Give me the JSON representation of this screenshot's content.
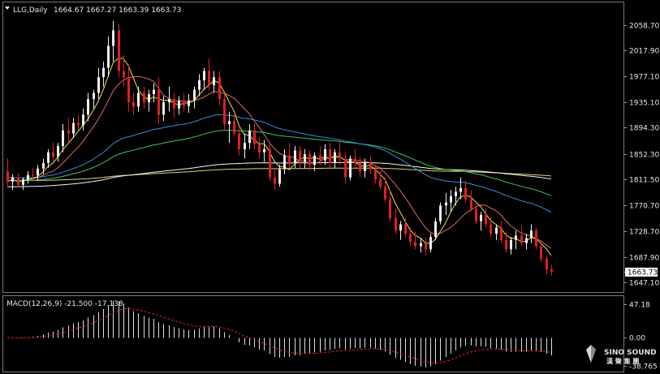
{
  "chart_data": [
    {
      "type": "candlestick",
      "header": {
        "symbol_period": "LLG,Daily",
        "ohlc_text": "1664.67 1667.27 1663.39 1663.73"
      },
      "ylim": [
        1637,
        2075
      ],
      "y_ticks": [
        "2058.70",
        "2017.90",
        "1977.10",
        "1935.10",
        "1894.30",
        "1852.30",
        "1811.50",
        "1770.70",
        "1728.70",
        "1687.90",
        "1647.10"
      ],
      "last_price": "1663.73",
      "colors": {
        "up": "#f0f0f0",
        "down": "#e02020",
        "ma5": "#e8e050",
        "ma10": "#e06a6a",
        "ma20": "#f0f0f0",
        "ma30": "#2f8fe8",
        "ma60": "#37c75a",
        "ma120": "#f5f5f5",
        "ma250": "#e6d070",
        "grid": "#606060"
      },
      "candles": [
        [
          1825,
          1845,
          1800,
          1808
        ],
        [
          1808,
          1820,
          1795,
          1815
        ],
        [
          1815,
          1822,
          1800,
          1803
        ],
        [
          1803,
          1815,
          1795,
          1812
        ],
        [
          1812,
          1825,
          1805,
          1819
        ],
        [
          1819,
          1830,
          1812,
          1818
        ],
        [
          1818,
          1835,
          1810,
          1829
        ],
        [
          1829,
          1845,
          1820,
          1838
        ],
        [
          1838,
          1860,
          1830,
          1855
        ],
        [
          1855,
          1870,
          1840,
          1848
        ],
        [
          1848,
          1870,
          1840,
          1865
        ],
        [
          1865,
          1900,
          1855,
          1890
        ],
        [
          1890,
          1910,
          1870,
          1885
        ],
        [
          1885,
          1910,
          1878,
          1902
        ],
        [
          1902,
          1915,
          1890,
          1898
        ],
        [
          1898,
          1925,
          1890,
          1915
        ],
        [
          1915,
          1950,
          1905,
          1940
        ],
        [
          1940,
          1955,
          1925,
          1950
        ],
        [
          1950,
          1990,
          1940,
          1975
        ],
        [
          1975,
          2000,
          1960,
          1990
        ],
        [
          1990,
          2040,
          1975,
          2025
        ],
        [
          2025,
          2065,
          2000,
          2050
        ],
        [
          2050,
          2060,
          1975,
          1985
        ],
        [
          1985,
          2010,
          1960,
          1975
        ],
        [
          1975,
          1995,
          1920,
          1935
        ],
        [
          1935,
          1950,
          1915,
          1928
        ],
        [
          1928,
          1960,
          1920,
          1950
        ],
        [
          1950,
          1960,
          1925,
          1935
        ],
        [
          1935,
          1955,
          1920,
          1948
        ],
        [
          1948,
          1965,
          1935,
          1955
        ],
        [
          1955,
          1975,
          1900,
          1915
        ],
        [
          1915,
          1945,
          1905,
          1935
        ],
        [
          1935,
          1960,
          1920,
          1940
        ],
        [
          1940,
          1950,
          1910,
          1925
        ],
        [
          1925,
          1945,
          1915,
          1938
        ],
        [
          1938,
          1950,
          1920,
          1929
        ],
        [
          1929,
          1948,
          1918,
          1938
        ],
        [
          1938,
          1960,
          1925,
          1955
        ],
        [
          1955,
          1980,
          1945,
          1970
        ],
        [
          1970,
          1990,
          1955,
          1985
        ],
        [
          1985,
          2005,
          1955,
          1962
        ],
        [
          1962,
          1985,
          1950,
          1975
        ],
        [
          1975,
          1985,
          1930,
          1940
        ],
        [
          1940,
          1950,
          1890,
          1900
        ],
        [
          1900,
          1920,
          1870,
          1905
        ],
        [
          1905,
          1915,
          1880,
          1885
        ],
        [
          1885,
          1895,
          1850,
          1860
        ],
        [
          1860,
          1885,
          1845,
          1870
        ],
        [
          1870,
          1900,
          1860,
          1890
        ],
        [
          1890,
          1900,
          1860,
          1868
        ],
        [
          1868,
          1880,
          1845,
          1855
        ],
        [
          1855,
          1875,
          1840,
          1860
        ],
        [
          1860,
          1868,
          1810,
          1815
        ],
        [
          1815,
          1830,
          1795,
          1805
        ],
        [
          1805,
          1835,
          1800,
          1828
        ],
        [
          1828,
          1860,
          1820,
          1850
        ],
        [
          1850,
          1870,
          1830,
          1838
        ],
        [
          1838,
          1865,
          1830,
          1858
        ],
        [
          1858,
          1865,
          1830,
          1840
        ],
        [
          1840,
          1860,
          1830,
          1852
        ],
        [
          1852,
          1858,
          1825,
          1835
        ],
        [
          1835,
          1855,
          1825,
          1850
        ],
        [
          1850,
          1865,
          1835,
          1842
        ],
        [
          1842,
          1868,
          1835,
          1860
        ],
        [
          1860,
          1870,
          1830,
          1838
        ],
        [
          1838,
          1860,
          1830,
          1855
        ],
        [
          1855,
          1875,
          1835,
          1845
        ],
        [
          1845,
          1855,
          1805,
          1815
        ],
        [
          1815,
          1850,
          1810,
          1845
        ],
        [
          1845,
          1860,
          1830,
          1838
        ],
        [
          1838,
          1848,
          1815,
          1825
        ],
        [
          1825,
          1845,
          1815,
          1838
        ],
        [
          1838,
          1850,
          1820,
          1828
        ],
        [
          1828,
          1835,
          1805,
          1812
        ],
        [
          1812,
          1825,
          1795,
          1800
        ],
        [
          1800,
          1815,
          1775,
          1780
        ],
        [
          1780,
          1795,
          1745,
          1750
        ],
        [
          1750,
          1765,
          1725,
          1730
        ],
        [
          1730,
          1745,
          1715,
          1740
        ],
        [
          1740,
          1750,
          1720,
          1725
        ],
        [
          1725,
          1735,
          1705,
          1712
        ],
        [
          1712,
          1728,
          1700,
          1705
        ],
        [
          1705,
          1718,
          1695,
          1710
        ],
        [
          1710,
          1720,
          1690,
          1700
        ],
        [
          1700,
          1725,
          1695,
          1720
        ],
        [
          1720,
          1750,
          1715,
          1745
        ],
        [
          1745,
          1775,
          1740,
          1770
        ],
        [
          1770,
          1790,
          1755,
          1775
        ],
        [
          1775,
          1795,
          1760,
          1785
        ],
        [
          1785,
          1800,
          1770,
          1792
        ],
        [
          1792,
          1815,
          1780,
          1798
        ],
        [
          1798,
          1810,
          1775,
          1780
        ],
        [
          1780,
          1795,
          1760,
          1765
        ],
        [
          1765,
          1775,
          1740,
          1745
        ],
        [
          1745,
          1760,
          1730,
          1755
        ],
        [
          1755,
          1765,
          1735,
          1740
        ],
        [
          1740,
          1752,
          1720,
          1725
        ],
        [
          1725,
          1740,
          1715,
          1735
        ],
        [
          1735,
          1745,
          1710,
          1715
        ],
        [
          1715,
          1728,
          1695,
          1700
        ],
        [
          1700,
          1720,
          1692,
          1715
        ],
        [
          1715,
          1730,
          1700,
          1722
        ],
        [
          1722,
          1738,
          1705,
          1710
        ],
        [
          1710,
          1725,
          1700,
          1718
        ],
        [
          1718,
          1740,
          1710,
          1730
        ],
        [
          1730,
          1735,
          1700,
          1705
        ],
        [
          1705,
          1712,
          1680,
          1685
        ],
        [
          1685,
          1690,
          1660,
          1668
        ],
        [
          1668,
          1675,
          1658,
          1664
        ]
      ],
      "macd": {
        "label": "MACD(12,26,9) -21.500 -17.138",
        "ylim": [
          -40,
          50
        ],
        "y_ticks": [
          "47.18",
          "0.00",
          "-38.765"
        ],
        "hist_color": "#e0e0e0",
        "signal_color": "#e02020"
      }
    }
  ],
  "watermark": {
    "brand": "SINO SOUND",
    "sub": "漢 聲 集 團"
  }
}
